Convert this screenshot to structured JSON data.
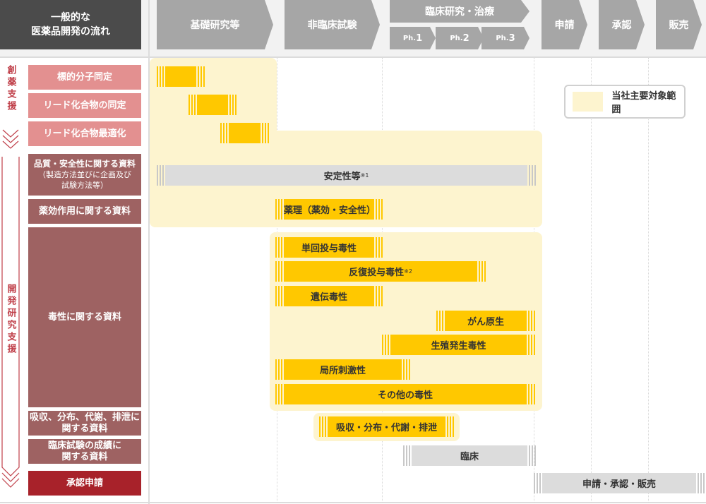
{
  "header": {
    "title_line1": "一般的な",
    "title_line2": "医薬品開発の流れ",
    "stages": [
      "基礎研究等",
      "非臨床試験",
      "臨床研究・治療",
      "申請",
      "承認",
      "販売"
    ],
    "phases": [
      {
        "prefix": "Ph.",
        "num": "1"
      },
      {
        "prefix": "Ph.",
        "num": "2"
      },
      {
        "prefix": "Ph.",
        "num": "3"
      }
    ]
  },
  "categories": {
    "drug_discovery": "創薬支援",
    "development": "開発研究支援"
  },
  "rows": {
    "r1": "標的分子同定",
    "r2": "リード化合物の同定",
    "r3": "リード化合物最適化",
    "r4_line1": "品質・安全性に関する資料",
    "r4_line2": "（製造方法並びに企画及び",
    "r4_line3": "試験方法等）",
    "r5": "薬効作用に関する資料",
    "r6": "毒性に関する資料",
    "r7_line1": "吸収、分布、代謝、排泄に",
    "r7_line2": "関する資料",
    "r8_line1": "臨床試験の成績に",
    "r8_line2": "関する資料",
    "r9": "承認申請"
  },
  "bars": {
    "safety": "安定性等",
    "safety_note": "※1",
    "pharmacology": "薬理（薬効・安全性）",
    "single_dose": "単回投与毒性",
    "repeat_dose": "反復投与毒性",
    "repeat_note": "※2",
    "genotox": "遺伝毒性",
    "carcino": "がん原生",
    "repro": "生殖発生毒性",
    "local": "局所刺激性",
    "other_tox": "その他の毒性",
    "adme": "吸収・分布・代謝・排泄",
    "clinical": "臨床",
    "approval": "申請・承認・販売"
  },
  "legend": {
    "label": "当社主要対象範囲"
  },
  "colors": {
    "highlight_yellow": "#ffc800",
    "scope_panel": "#fdf4cf",
    "pink_label": "#e39090",
    "brown_label": "#9e6262",
    "approval_red": "#a8222a",
    "stage_gray": "#a6a6a6",
    "header_dark": "#4b4b4b"
  }
}
